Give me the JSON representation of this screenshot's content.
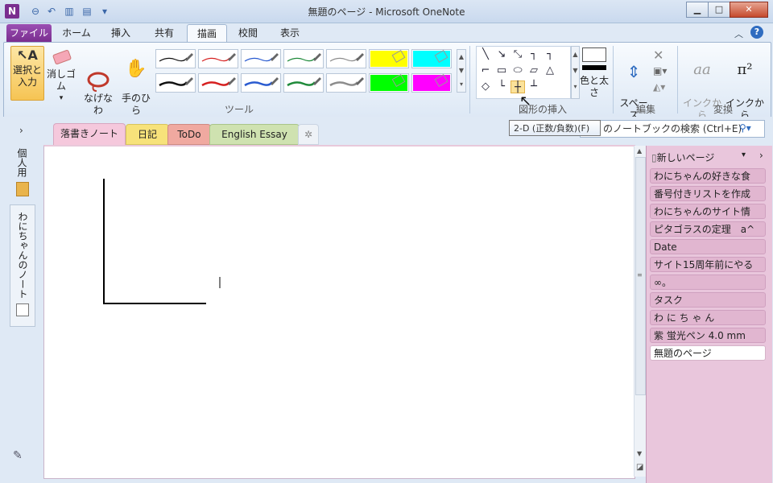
{
  "window": {
    "title": "無題のページ - Microsoft OneNote",
    "app_icon_letter": "N",
    "minimize": "▁",
    "maximize": "□",
    "close": "✕"
  },
  "ribbon_tabs": [
    "ファイル",
    "ホーム",
    "挿入",
    "共有",
    "描画",
    "校閲",
    "表示"
  ],
  "selected_tab": "描画",
  "tools": {
    "select_type": "選択と\n入力",
    "eraser": "消しゴム",
    "lasso": "なげなわ\n選択",
    "pan": "手のひら\nツール",
    "group_label": "ツール",
    "pens_row1": [
      "#111111",
      "#d62020",
      "#2a5bd0",
      "#1f8a3a",
      "#8c8c8c",
      "#ffff00",
      "#00ffff"
    ],
    "pens_row2": [
      "#111111",
      "#d62020",
      "#2a5bd0",
      "#1f8a3a",
      "#8c8c8c",
      "#00ff00",
      "#ff00ff"
    ]
  },
  "shapes": {
    "group_label": "図形の挿入",
    "color_thickness": "色と太さ"
  },
  "edit": {
    "insert_space": "スペース\nの挿入",
    "group_label": "編集"
  },
  "convert": {
    "ink_to_text": "インクから\nテキスト",
    "ink_to_math": "インクから\n数式",
    "group_label": "変換"
  },
  "tooltip": "2-D (正数/負数)(F)",
  "search": {
    "placeholder": "のノートブックの検索 (Ctrl+E)"
  },
  "sections": [
    {
      "label": "落書きノート",
      "color": "#f5c8dc"
    },
    {
      "label": "日記",
      "color": "#f7e27a"
    },
    {
      "label": "ToDo",
      "color": "#f0a9a0"
    },
    {
      "label": "English Essay",
      "color": "#cfe2b0"
    }
  ],
  "notebooks": {
    "personal": "個人用",
    "wani": "わにちゃんのノート"
  },
  "pages": {
    "new_page": "新しいページ",
    "items": [
      "わにちゃんの好きな食",
      "番号付きリストを作成",
      "わにちゃんのサイト情",
      "ピタゴラスの定理　a^",
      "Date",
      "サイト15周年前にやる",
      "∞。",
      "タスク",
      "わ に ち ゃ ん",
      "紫 蛍光ペン 4.0 mm",
      "無題のページ"
    ],
    "selected": "無題のページ"
  }
}
